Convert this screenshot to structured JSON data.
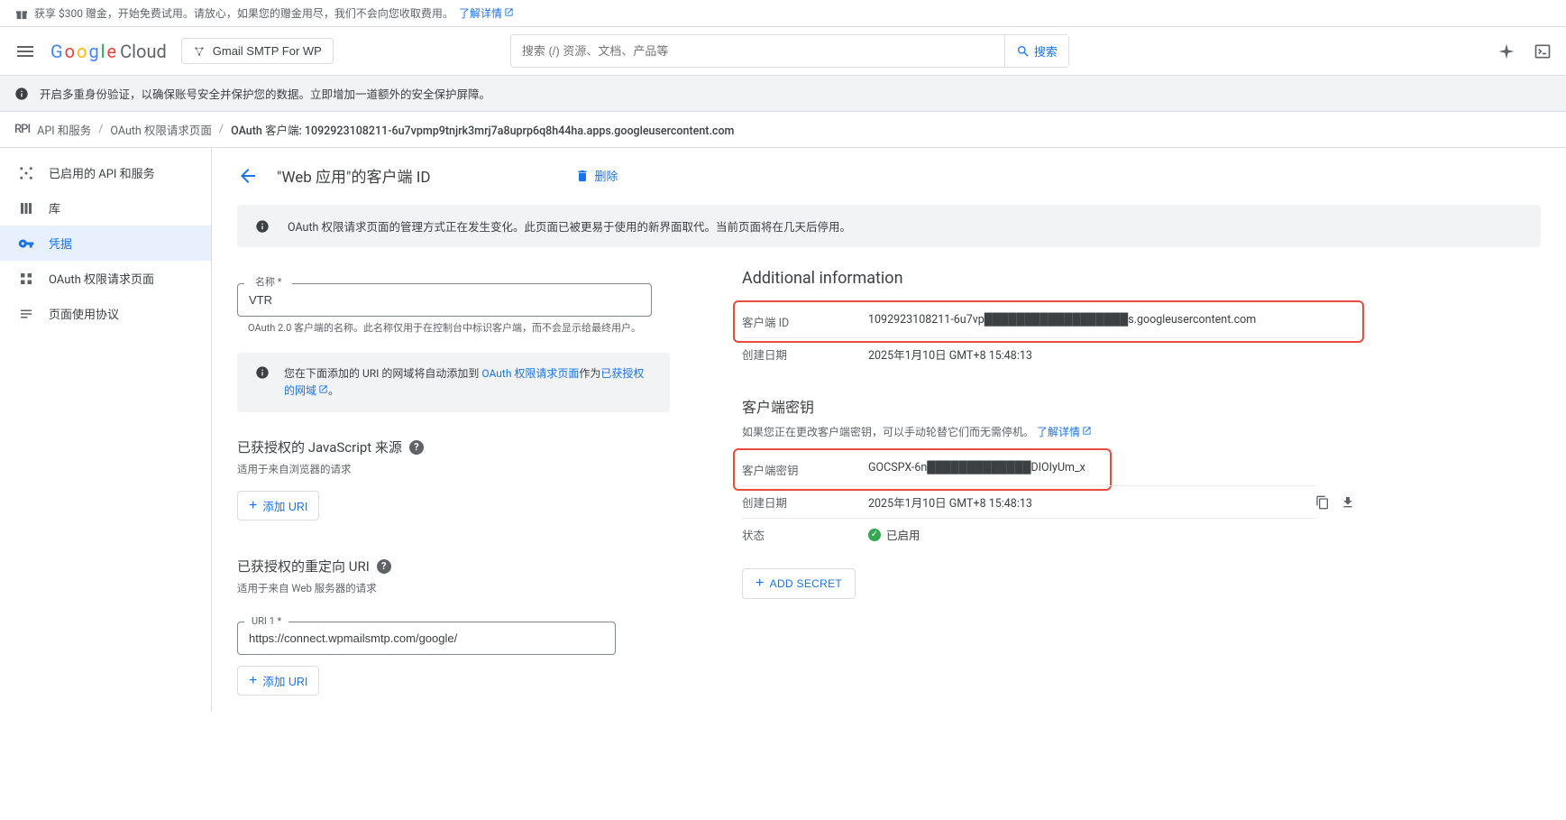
{
  "promo": {
    "text": "获享 $300 赠金，开始免费试用。请放心，如果您的赠金用尽，我们不会向您收取费用。",
    "link": "了解详情"
  },
  "header": {
    "logo_cloud": "Cloud",
    "project": "Gmail SMTP For WP",
    "search_placeholder": "搜索 (/) 资源、文档、产品等",
    "search_btn": "搜索"
  },
  "mfa_notice": "开启多重身份验证，以确保账号安全并保护您的数据。立即增加一道额外的安全保护屏障。",
  "breadcrumb": {
    "root": "API 和服务",
    "mid": "OAuth 权限请求页面",
    "leaf": "OAuth 客户端: 1092923108211-6u7vpmp9tnjrk3mrj7a8uprp6q8h44ha.apps.googleusercontent.com"
  },
  "sidebar": {
    "enabled": "已启用的 API 和服务",
    "library": "库",
    "credentials": "凭据",
    "consent": "OAuth 权限请求页面",
    "terms": "页面使用协议"
  },
  "page": {
    "title": "\"Web 应用\"的客户端 ID",
    "delete": "删除",
    "change_note": "OAuth 权限请求页面的管理方式正在发生变化。此页面已被更易于使用的新界面取代。当前页面将在几天后停用。",
    "name_label": "名称 *",
    "name_value": "VTR",
    "name_help": "OAuth 2.0 客户端的名称。此名称仅用于在控制台中标识客户端，而不会显示给最终用户。",
    "domain_note_pre": "您在下面添加的 URI 的网域将自动添加到 ",
    "domain_note_link1": "OAuth 权限请求页面",
    "domain_note_mid": "作为",
    "domain_note_link2": "已获授权的网域",
    "domain_note_post": "。",
    "js_title": "已获授权的 JavaScript 来源",
    "js_sub": "适用于来自浏览器的请求",
    "add_uri": "添加 URI",
    "redirect_title": "已获授权的重定向 URI",
    "redirect_sub": "适用于来自 Web 服务器的请求",
    "uri1_label": "URI 1 *",
    "uri1_value": "https://connect.wpmailsmtp.com/google/"
  },
  "right": {
    "additional_title": "Additional information",
    "clientid_key": "客户端 ID",
    "clientid_val": "1092923108211-6u7vp██████████████████s.googleusercontent.com",
    "created_key": "创建日期",
    "created_val": "2025年1月10日 GMT+8 15:48:13",
    "secret_title": "客户端密钥",
    "secret_sub": "如果您正在更改客户端密钥，可以手动轮替它们而无需停机。",
    "secret_link": "了解详情",
    "secret_key": "客户端密钥",
    "secret_val": "GOCSPX-6n█████████████DIOIyUm_x",
    "secret_created_key": "创建日期",
    "secret_created_val": "2025年1月10日 GMT+8 15:48:13",
    "status_key": "状态",
    "status_val": "已启用",
    "add_secret": "ADD SECRET"
  }
}
